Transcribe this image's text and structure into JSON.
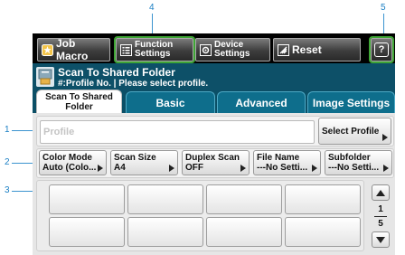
{
  "callouts": [
    "1",
    "2",
    "3",
    "4",
    "5"
  ],
  "toolbar": {
    "job_macro": "Job Macro",
    "function_settings": [
      "Function",
      "Settings"
    ],
    "device_settings": [
      "Device",
      "Settings"
    ],
    "reset": "Reset",
    "help": "?"
  },
  "header": {
    "title": "Scan To Shared Folder",
    "subtitle": "#:Profile No. | Please select profile."
  },
  "tabs": [
    {
      "label": [
        "Scan To Shared",
        "Folder"
      ],
      "active": true
    },
    {
      "label": "Basic",
      "active": false
    },
    {
      "label": "Advanced",
      "active": false
    },
    {
      "label": "Image Settings",
      "active": false
    }
  ],
  "profile": {
    "placeholder": "Profile",
    "select_button": "Select Profile"
  },
  "settings": [
    {
      "name": "Color Mode",
      "value": "Auto (Colo..."
    },
    {
      "name": "Scan Size",
      "value": "A4"
    },
    {
      "name": "Duplex Scan",
      "value": "OFF"
    },
    {
      "name": "File Name",
      "value": "---No Setti..."
    },
    {
      "name": "Subfolder",
      "value": "---No Setti..."
    }
  ],
  "pager": {
    "current": "1",
    "total": "5"
  },
  "colors": {
    "callout": "#1a7fc4",
    "highlight": "#3fa535",
    "header_bg": "#0d5068",
    "tab_bg": "#0e6e8c"
  }
}
